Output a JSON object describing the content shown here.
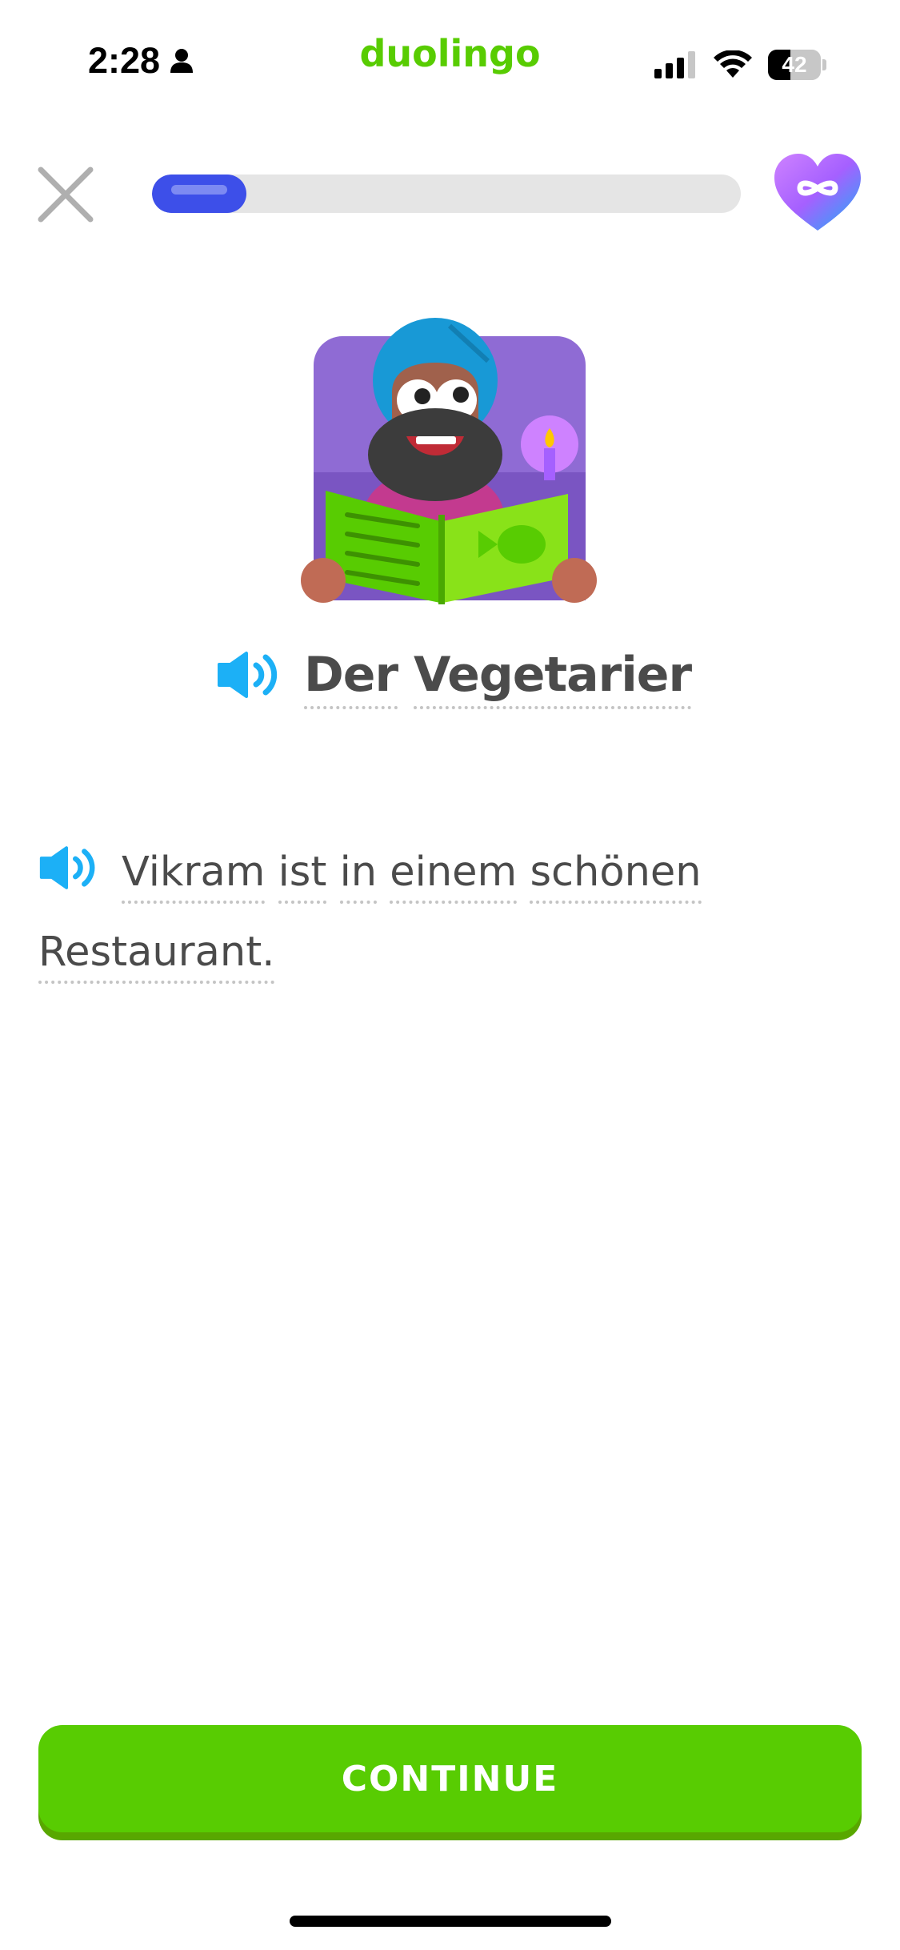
{
  "status_bar": {
    "time": "2:28",
    "battery_level": "42",
    "battery_fraction": 0.42,
    "icons": [
      "person-icon",
      "cellular-signal-icon",
      "wifi-icon",
      "battery-icon"
    ]
  },
  "app": {
    "name": "duolingo",
    "brand_color": "#58cc02"
  },
  "lesson_header": {
    "close_icon": "close-icon",
    "progress_fraction": 0.16,
    "progress_color": "#3d4fe9",
    "hearts_icon": "infinity-heart-icon"
  },
  "story": {
    "illustration": "vikram-reading-menu-illustration",
    "title_words": [
      "Der",
      "Vegetarier"
    ],
    "sentence_words": [
      "Vikram",
      "ist",
      "in",
      "einem",
      "schönen",
      "Restaurant."
    ],
    "speaker_icon": "speaker-icon",
    "speaker_color": "#1cb0f6"
  },
  "footer": {
    "continue_label": "CONTINUE",
    "button_color": "#58cc02"
  }
}
